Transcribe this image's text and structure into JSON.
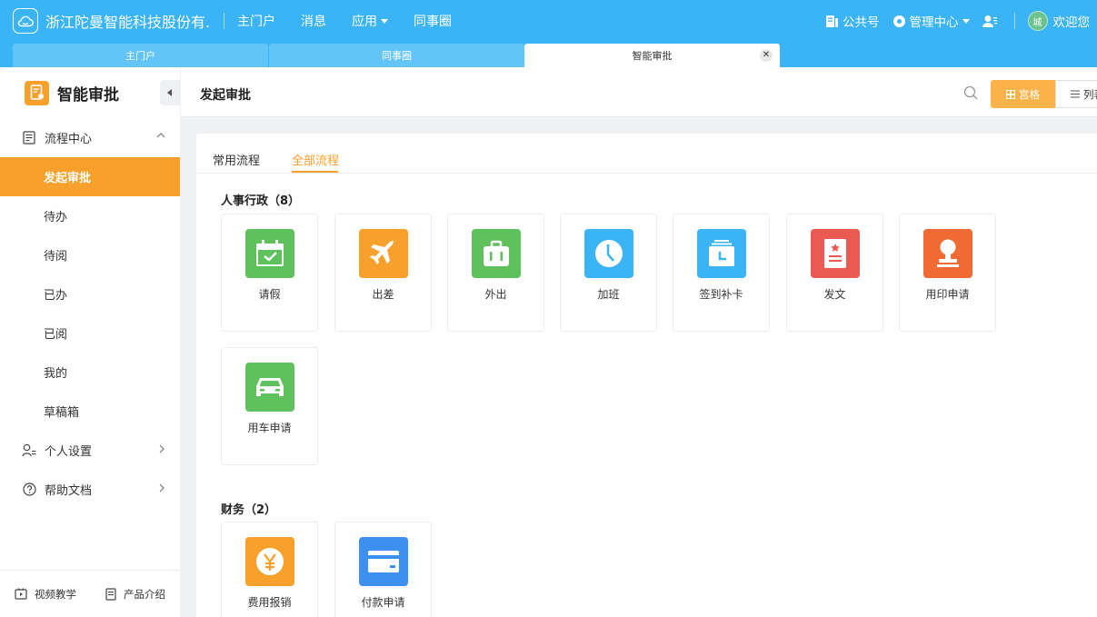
{
  "topbar": {
    "company": "浙江陀曼智能科技股份有...",
    "nav": [
      "主门户",
      "消息",
      "应用",
      "同事圈"
    ],
    "public_account": "公共号",
    "admin_center": "管理中心",
    "avatar_text": "城",
    "welcome": "欢迎您"
  },
  "window_tabs": [
    "主门户",
    "同事圈",
    "智能审批"
  ],
  "sidebar": {
    "title": "智能审批",
    "group_flow": "流程中心",
    "items": [
      "发起审批",
      "待办",
      "待阅",
      "已办",
      "已阅",
      "我的",
      "草稿箱"
    ],
    "group_personal": "个人设置",
    "group_help": "帮助文档",
    "footer_video": "视频教学",
    "footer_product": "产品介绍"
  },
  "main": {
    "title": "发起审批",
    "view_grid": "宫格",
    "view_list": "列表",
    "tabs": [
      "常用流程",
      "全部流程"
    ],
    "sections": [
      {
        "title": "人事行政（8）",
        "items": [
          {
            "label": "请假",
            "icon": "calendar-check-icon",
            "color": "#5ec15b"
          },
          {
            "label": "出差",
            "icon": "airplane-icon",
            "color": "#f7a02b"
          },
          {
            "label": "外出",
            "icon": "briefcase-icon",
            "color": "#5ec15b"
          },
          {
            "label": "加班",
            "icon": "clock-icon",
            "color": "#3ab4f5"
          },
          {
            "label": "签到补卡",
            "icon": "card-stack-icon",
            "color": "#3ab4f5"
          },
          {
            "label": "发文",
            "icon": "document-icon",
            "color": "#ea5a52"
          },
          {
            "label": "用印申请",
            "icon": "stamp-icon",
            "color": "#f06a33"
          },
          {
            "label": "用车申请",
            "icon": "car-icon",
            "color": "#5ec15b"
          }
        ]
      },
      {
        "title": "财务（2）",
        "items": [
          {
            "label": "费用报销",
            "icon": "yen-icon",
            "color": "#f7a02b"
          },
          {
            "label": "付款申请",
            "icon": "credit-card-icon",
            "color": "#3d8ff0"
          }
        ]
      }
    ]
  }
}
